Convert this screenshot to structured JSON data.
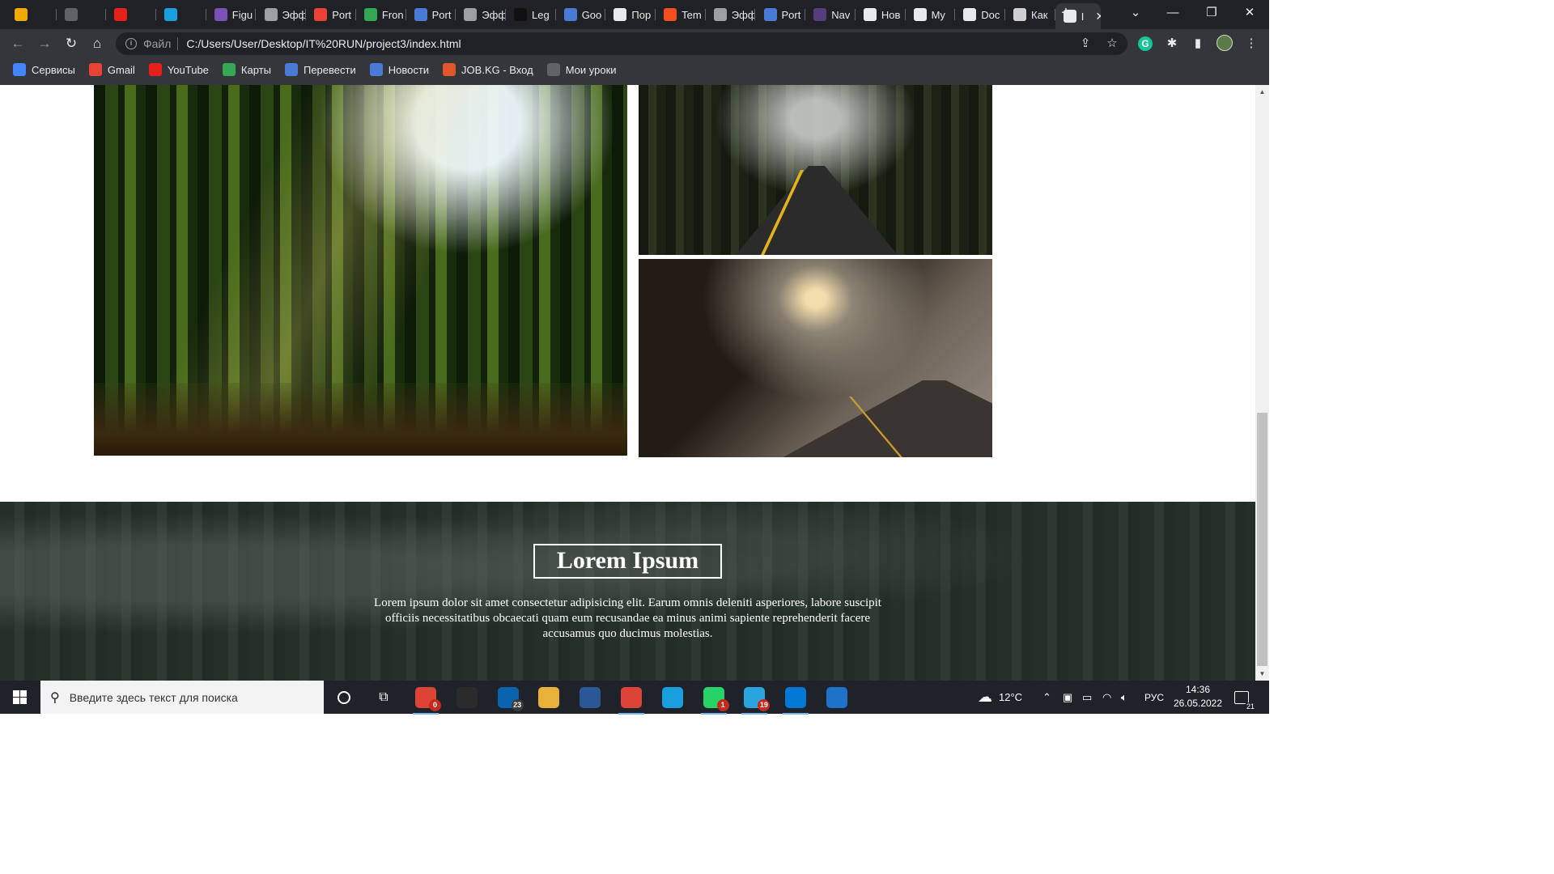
{
  "browser": {
    "tabs": [
      {
        "label": "",
        "icon": "duck-icon",
        "color": "#f2a900"
      },
      {
        "label": "",
        "icon": "at-logo-icon",
        "color": "#5f6368"
      },
      {
        "label": "",
        "icon": "youtube-icon",
        "color": "#e62117"
      },
      {
        "label": "",
        "icon": "edge-pen-icon",
        "color": "#1a9fde"
      },
      {
        "label": "Figu",
        "icon": "bootstrap-icon",
        "color": "#7952b3"
      },
      {
        "label": "Эфф",
        "icon": "css-icon",
        "color": "#9aa0a6"
      },
      {
        "label": "Port",
        "icon": "gmail-icon",
        "color": "#ea4335"
      },
      {
        "label": "Fron",
        "icon": "drive-icon",
        "color": "#34a853"
      },
      {
        "label": "Port",
        "icon": "profile-icon",
        "color": "#4a7bd6"
      },
      {
        "label": "Эфф",
        "icon": "css-icon",
        "color": "#9aa0a6"
      },
      {
        "label": "Leg",
        "icon": "regex-icon",
        "color": "#111111"
      },
      {
        "label": "Goo",
        "icon": "translate-icon",
        "color": "#4a7bd6"
      },
      {
        "label": "Пор",
        "icon": "globe-icon",
        "color": "#e8eaed"
      },
      {
        "label": "Tem",
        "icon": "figma-icon",
        "color": "#f24e1e"
      },
      {
        "label": "Эфф",
        "icon": "css-icon",
        "color": "#9aa0a6"
      },
      {
        "label": "Port",
        "icon": "profile-icon",
        "color": "#4a7bd6"
      },
      {
        "label": "Nav",
        "icon": "bootstrap-icon",
        "color": "#563d7c"
      },
      {
        "label": "Нов",
        "icon": "globe-icon",
        "color": "#e8eaed"
      },
      {
        "label": "My",
        "icon": "globe-icon",
        "color": "#e8eaed"
      },
      {
        "label": "Doc",
        "icon": "globe-icon",
        "color": "#e8eaed"
      },
      {
        "label": "Как",
        "icon": "spark-icon",
        "color": "#cfcfcf"
      },
      {
        "label": "I",
        "icon": "globe-icon",
        "color": "#e8eaed",
        "active": true
      }
    ],
    "new_tab_symbol": "+",
    "address": {
      "scheme_label": "Файл",
      "url": "C:/Users/User/Desktop/IT%20RUN/project3/index.html"
    },
    "bookmarks": [
      {
        "label": "Сервисы",
        "icon": "apps-grid-icon",
        "color": "#4285f4"
      },
      {
        "label": "Gmail",
        "icon": "gmail-icon",
        "color": "#ea4335"
      },
      {
        "label": "YouTube",
        "icon": "youtube-icon",
        "color": "#e62117"
      },
      {
        "label": "Карты",
        "icon": "maps-icon",
        "color": "#34a853"
      },
      {
        "label": "Перевести",
        "icon": "translate-icon",
        "color": "#4a7bd6"
      },
      {
        "label": "Новости",
        "icon": "news-icon",
        "color": "#4a7bd6"
      },
      {
        "label": "JOB.KG - Вход",
        "icon": "jobkg-icon",
        "color": "#e2562a"
      },
      {
        "label": "Мои уроки",
        "icon": "at-logo-icon",
        "color": "#5f6368"
      }
    ]
  },
  "page": {
    "hero": {
      "title": "Lorem Ipsum",
      "text": "Lorem ipsum dolor sit amet consectetur adipisicing elit. Earum omnis deleniti asperiores, labore suscipit officiis necessitatibus obcaecati quam eum recusandae ea minus animi sapiente reprehenderit facere accusamus quo ducimus molestias."
    }
  },
  "taskbar": {
    "search_placeholder": "Введите здесь текст для поиска",
    "apps": [
      {
        "name": "chrome-profile",
        "icon": "chrome-icon",
        "color": "#db4437",
        "badge": "0",
        "badge_style": "red",
        "active": true
      },
      {
        "name": "store",
        "icon": "store-icon",
        "color": "#2b2b2b",
        "badge": ""
      },
      {
        "name": "mail",
        "icon": "mail-icon",
        "color": "#0a64ad",
        "badge": "23",
        "badge_style": "grey"
      },
      {
        "name": "explorer",
        "icon": "folder-icon",
        "color": "#e8b23a",
        "badge": ""
      },
      {
        "name": "word",
        "icon": "word-icon",
        "color": "#2b5797",
        "badge": ""
      },
      {
        "name": "chrome",
        "icon": "chrome-icon",
        "color": "#db4437",
        "badge": "",
        "active": true
      },
      {
        "name": "edge",
        "icon": "edge-icon",
        "color": "#1a9fde",
        "badge": ""
      },
      {
        "name": "whatsapp",
        "icon": "whatsapp-icon",
        "color": "#25d366",
        "badge": "1",
        "badge_style": "red",
        "active": true
      },
      {
        "name": "telegram",
        "icon": "telegram-icon",
        "color": "#2aa3df",
        "badge": "19",
        "badge_style": "red",
        "active": true
      },
      {
        "name": "vscode",
        "icon": "vscode-icon",
        "color": "#0078d4",
        "badge": "",
        "active": true
      },
      {
        "name": "photos",
        "icon": "photos-icon",
        "color": "#1f72c9",
        "badge": ""
      }
    ],
    "weather": "12°C",
    "language": "РУС",
    "time": "14:36",
    "date": "26.05.2022",
    "notifications": "21"
  }
}
